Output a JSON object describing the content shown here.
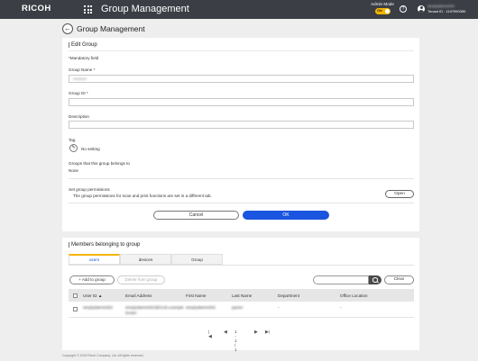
{
  "header": {
    "logo": "RICOH",
    "app_title": "Group Management",
    "admin_mode_label": "Admin Mode",
    "toggle_label": "ON",
    "help_icon": "question-circle-icon",
    "user_icon": "user-circle-icon",
    "user_name": "simplydatmin002",
    "tenant_id": "Tenant ID : 1197990390"
  },
  "page": {
    "title": "Group Management",
    "back_icon": "arrow-left-icon"
  },
  "edit": {
    "section_title": "Edit Group",
    "mandatory_note": "*Mandatory field",
    "group_name_label": "Group Name *",
    "group_name_value": "mmmm",
    "group_id_label": "Group ID *",
    "group_id_value": "",
    "description_label": "Description",
    "description_value": "",
    "tag_label": "Tag",
    "tag_value": "No setting",
    "tag_icon": "pencil-icon",
    "belongs_label": "Groups that this group belongs to",
    "belongs_value": "None",
    "permissions_label": "Set group permissions",
    "permissions_note": "The group permissions for scan and print functions are set in a different tab.",
    "open_button": "Open",
    "cancel_button": "Cancel",
    "ok_button": "OK"
  },
  "members": {
    "section_title": "Members belonging to group",
    "tabs": [
      "users",
      "devices",
      "Group"
    ],
    "active_tab": "users",
    "add_button": "+ Add to group",
    "delete_button": "Delete from group",
    "search_placeholder": "",
    "clear_button": "Clear",
    "columns": [
      "User ID ▲",
      "Email Address",
      "First Name",
      "Last Name",
      "Department",
      "Office Location"
    ],
    "rows": [
      {
        "user_id": "simplydatmin002",
        "email_line1": "simplydatmin002@ricoh.example",
        "email_line2": "tenant",
        "first_name": "simplydatmin002",
        "last_name": "ppeter",
        "department": "-",
        "office_location": "-"
      }
    ],
    "pagination": "1 - 1 / 1"
  },
  "footer": {
    "copyright": "Copyright © 2019 Ricoh Company, Ltd. All rights reserved."
  },
  "colors": {
    "header_bg": "#3b3f45",
    "accent": "#f7b500",
    "primary": "#1a55e0"
  }
}
